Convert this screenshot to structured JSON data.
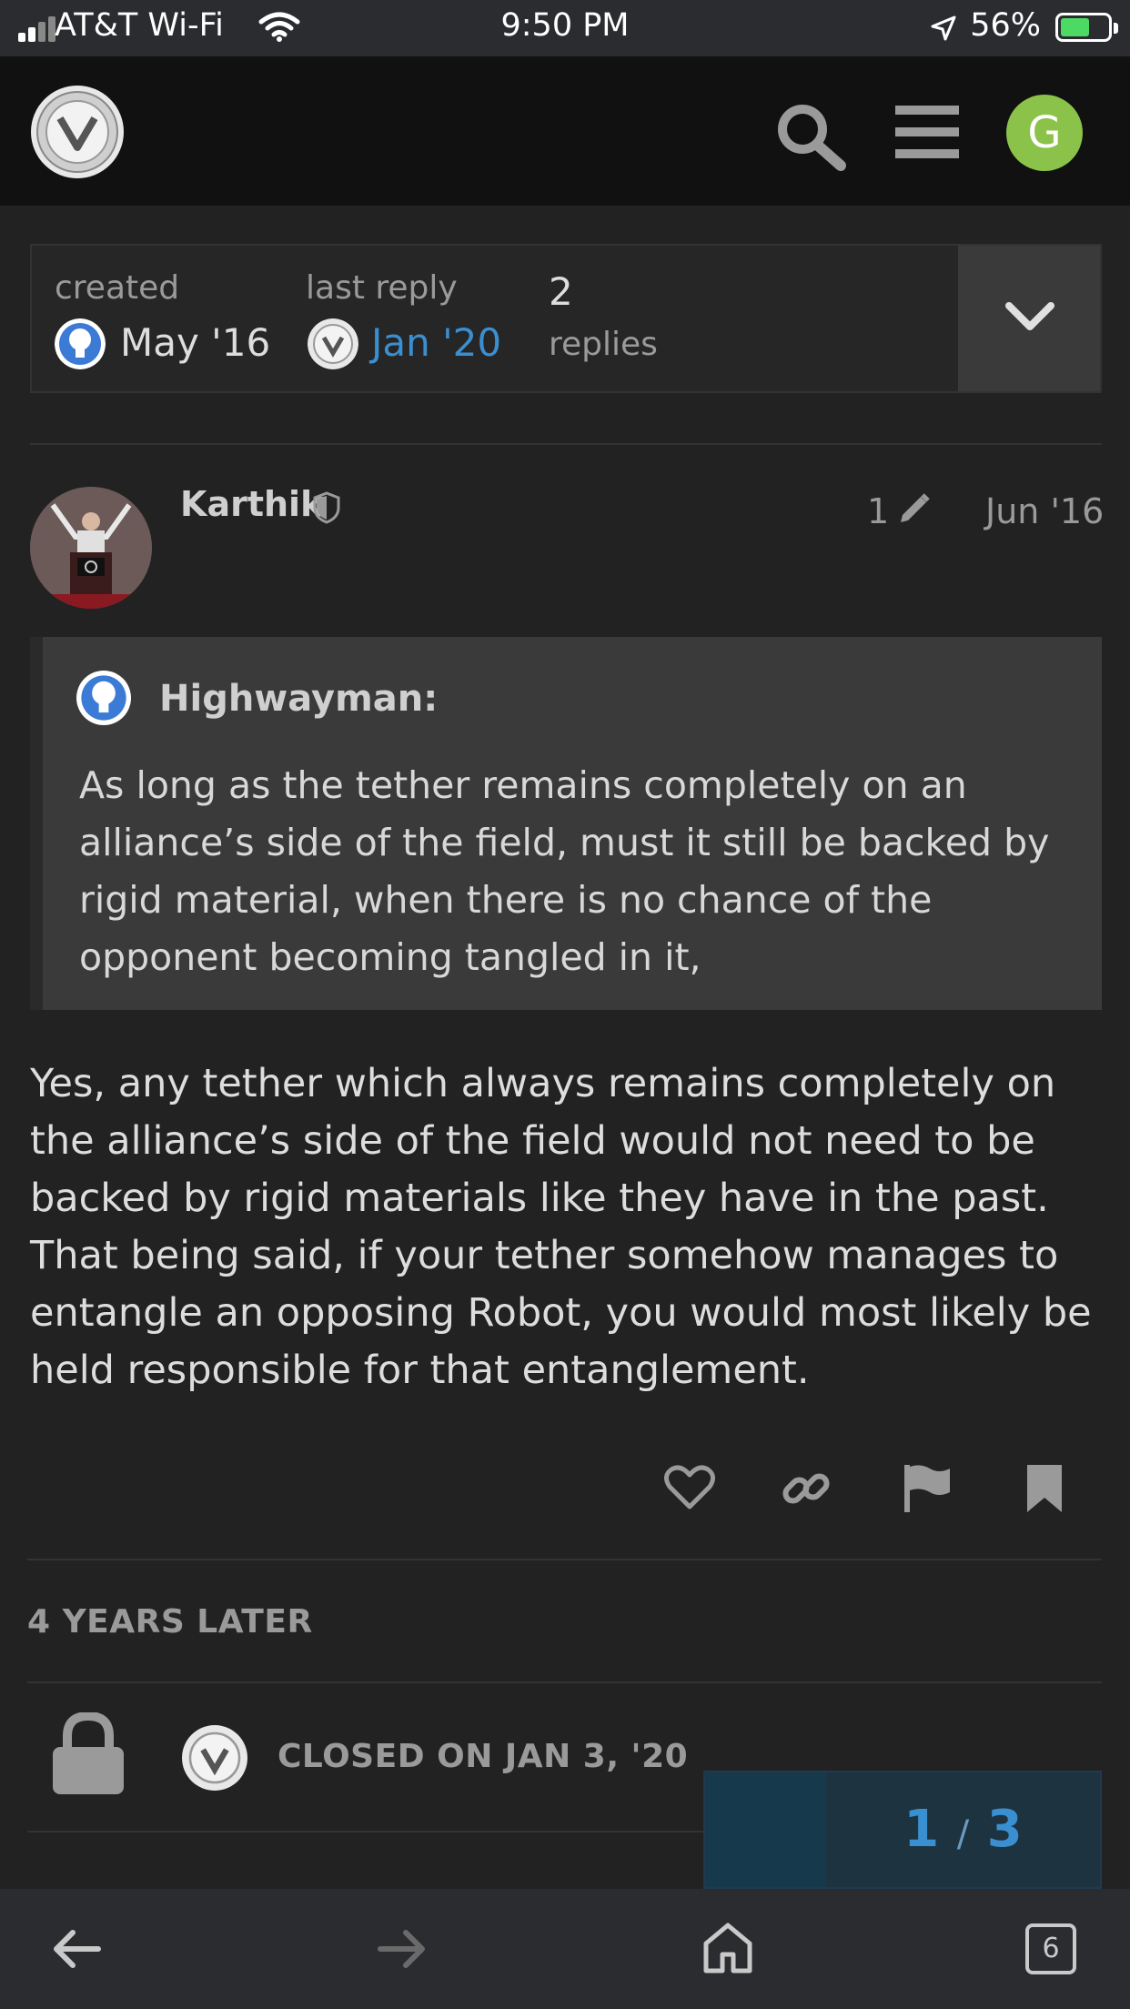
{
  "status_bar": {
    "carrier": "AT&T Wi-Fi",
    "time": "9:50 PM",
    "battery": "56%",
    "battery_level": 0.56
  },
  "header": {
    "user_initial": "G",
    "avatar_color": "#8bc34a"
  },
  "topic_map": {
    "created_label": "created",
    "created_value": "May '16",
    "last_reply_label": "last reply",
    "last_reply_value": "Jan '20",
    "replies_count": "2",
    "replies_label": "replies"
  },
  "post": {
    "username": "Karthik",
    "edit_count": "1",
    "date": "Jun '16",
    "quote": {
      "author": "Highwayman:",
      "text": "As long as the tether remains completely on an alliance’s side of the field, must it still be backed by rigid material, when there is no chance of the opponent becoming tangled in it,"
    },
    "body": "Yes, any tether which always remains completely on the alliance’s side of the field would not need to be backed by rigid materials like they have in the past. That being said, if your tether somehow manages to entangle an opposing Robot, you would most likely be held responsible for that entanglement."
  },
  "time_gap": "4 YEARS LATER",
  "closed_notice": "CLOSED ON JAN 3, '20",
  "progress": {
    "current": "1",
    "separator": "/",
    "total": "3"
  },
  "browser": {
    "tabs_count": "6"
  },
  "colors": {
    "link": "#3a8fd0",
    "background": "#222222",
    "header": "#111111"
  }
}
